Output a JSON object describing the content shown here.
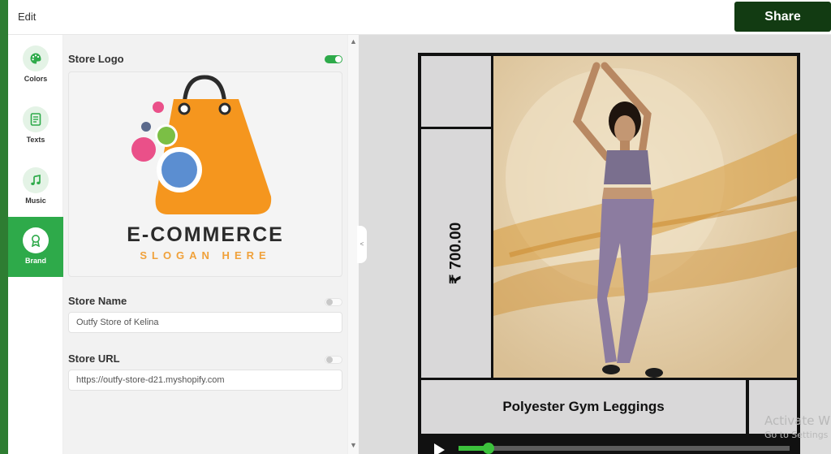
{
  "topbar": {
    "edit_label": "Edit",
    "share_label": "Share"
  },
  "sidebar": {
    "items": [
      {
        "label": "Colors",
        "icon": "palette-icon",
        "active": false
      },
      {
        "label": "Texts",
        "icon": "document-icon",
        "active": false
      },
      {
        "label": "Music",
        "icon": "music-note-icon",
        "active": false
      },
      {
        "label": "Brand",
        "icon": "badge-icon",
        "active": true
      }
    ]
  },
  "panel": {
    "store_logo": {
      "label": "Store Logo",
      "enabled": true,
      "logo_text": "E-COMMERCE",
      "logo_subtext": "SLOGAN HERE"
    },
    "store_name": {
      "label": "Store Name",
      "enabled": false,
      "value": "Outfy Store of Kelina"
    },
    "store_url": {
      "label": "Store URL",
      "enabled": false,
      "value": "https://outfy-store-d21.myshopify.com"
    }
  },
  "preview": {
    "price": "₹ 700.00",
    "product_title": "Polyester Gym Leggings",
    "playback_progress": 0.09
  },
  "watermark": {
    "line1": "Activate W",
    "line2": "Go to Settings"
  },
  "colors": {
    "accent": "#2eaa4a",
    "share_button": "#123b12",
    "progress": "#3cc13c"
  }
}
